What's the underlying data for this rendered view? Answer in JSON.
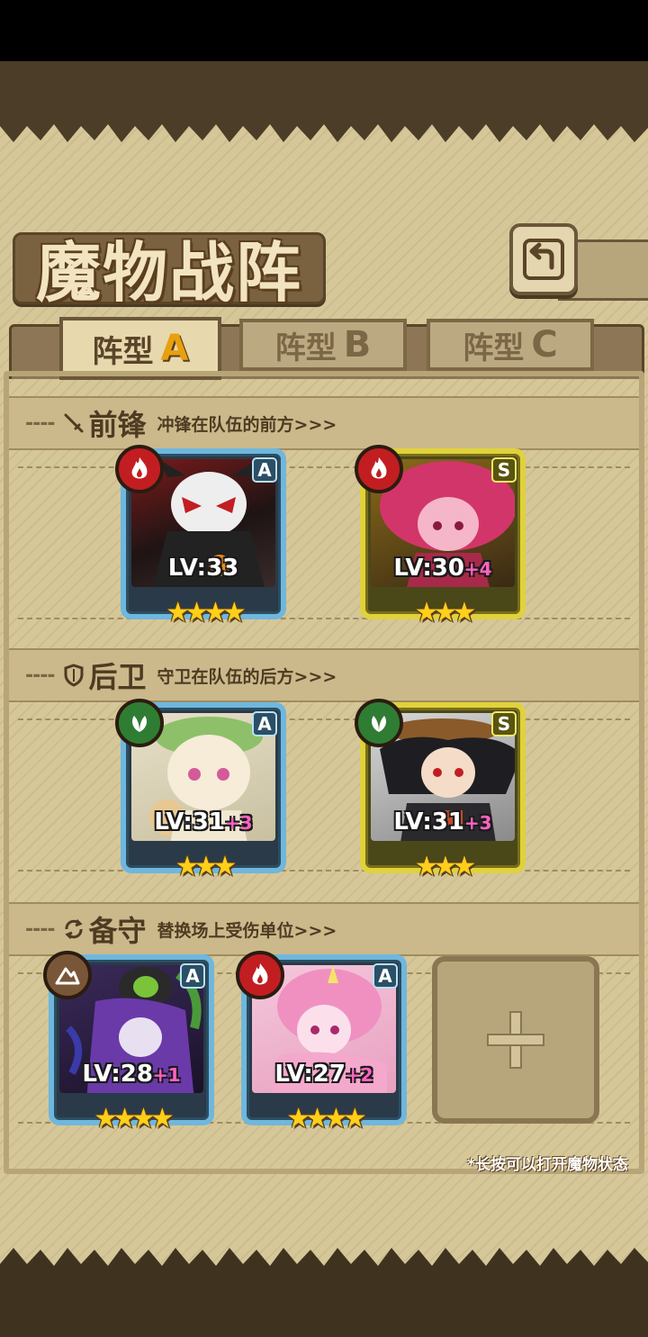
{
  "title": "魔物战阵",
  "back_icon": "back-arrow-icon",
  "tabs": [
    {
      "label": "阵型",
      "letter": "A",
      "active": true
    },
    {
      "label": "阵型",
      "letter": "B",
      "active": false
    },
    {
      "label": "阵型",
      "letter": "C",
      "active": false
    }
  ],
  "sections": {
    "vanguard": {
      "dash": "----",
      "title": "前锋",
      "desc": "冲锋在队伍的前方>>>"
    },
    "rearguard": {
      "dash": "----",
      "title": "后卫",
      "desc": "守卫在队伍的后方>>>"
    },
    "reserve": {
      "dash": "----",
      "title": "备守",
      "desc": "替换场上受伤单位>>>"
    }
  },
  "cards": {
    "v1": {
      "rank": "A",
      "element": "fire",
      "lv": "LV:33",
      "plus": "",
      "stars": "★★★★"
    },
    "v2": {
      "rank": "S",
      "element": "fire",
      "lv": "LV:30",
      "plus": "+4",
      "stars": "★★★"
    },
    "r1": {
      "rank": "A",
      "element": "leaf",
      "lv": "LV:31",
      "plus": "+3",
      "stars": "★★★"
    },
    "r2": {
      "rank": "S",
      "element": "leaf",
      "lv": "LV:31",
      "plus": "+3",
      "stars": "★★★"
    },
    "b1": {
      "rank": "A",
      "element": "earth",
      "lv": "LV:28",
      "plus": "+1",
      "stars": "★★★★"
    },
    "b2": {
      "rank": "A",
      "element": "fire",
      "lv": "LV:27",
      "plus": "+2",
      "stars": "★★★★"
    }
  },
  "empty_slot_icon": "plus-icon",
  "hint": "*长按可以打开魔物状态",
  "colors": {
    "rank_a_border": "#6fb7dd",
    "rank_s_border": "#dfd23c",
    "fire": "#c21e22",
    "leaf": "#2f7d33",
    "earth": "#7a5638",
    "active_letter": "#e8a010"
  }
}
